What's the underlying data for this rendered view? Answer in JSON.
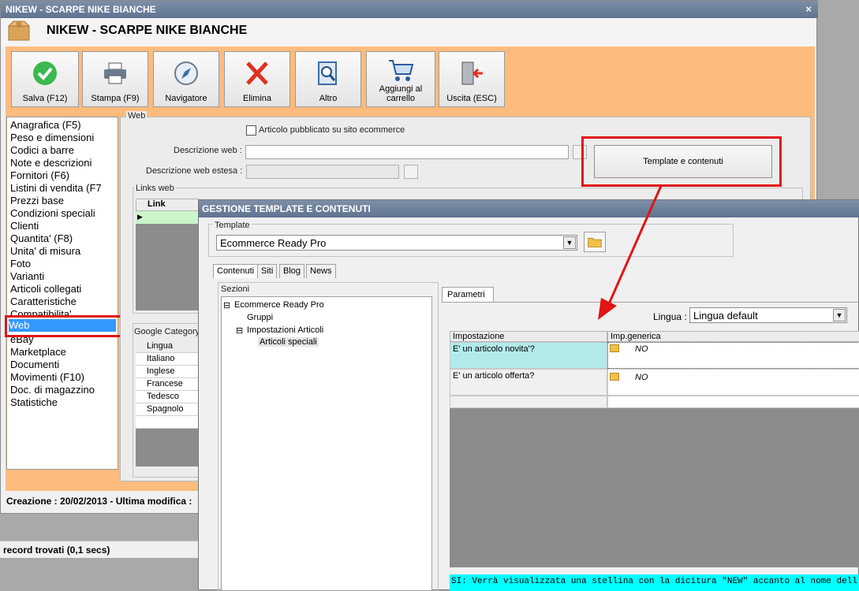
{
  "window": {
    "title": "NIKEW - SCARPE NIKE BIANCHE",
    "item_title": "NIKEW - SCARPE NIKE BIANCHE",
    "close": "×"
  },
  "toolbar": [
    {
      "label": "Salva (F12)",
      "icon": "check-icon"
    },
    {
      "label": "Stampa (F9)",
      "icon": "printer-icon"
    },
    {
      "label": "Navigatore",
      "icon": "compass-icon"
    },
    {
      "label": "Elimina",
      "icon": "delete-x-icon"
    },
    {
      "label": "Altro",
      "icon": "search-document-icon"
    },
    {
      "label": "Aggiungi al carrello",
      "icon": "cart-icon"
    },
    {
      "label": "Uscita (ESC)",
      "icon": "exit-door-icon"
    }
  ],
  "nav": {
    "items": [
      "Anagrafica (F5)",
      "Peso e dimensioni",
      "Codici a barre",
      "Note e descrizioni",
      "Fornitori (F6)",
      "Listini di vendita (F7",
      "Prezzi base",
      "Condizioni speciali",
      "Clienti",
      "Quantita' (F8)",
      "Unita' di misura",
      "Foto",
      "Varianti",
      "Articoli collegati",
      "Caratteristiche",
      "Compatibilita'",
      "Web",
      "eBay",
      "Marketplace",
      "Documenti",
      "Movimenti (F10)",
      "Doc. di magazzino",
      "Statistiche"
    ],
    "selected": "Web"
  },
  "web": {
    "group_label": "Web",
    "checkbox_label": "Articolo pubblicato su sito ecommerce",
    "descr_label": "Descrizione web :",
    "descr_value": "",
    "descr_ext_label": "Descrizione web estesa :",
    "template_button": "Template e contenuti",
    "links_label": "Links web",
    "links_col": "Link",
    "google_label": "Google Category",
    "languages": [
      "Lingua",
      "Italiano",
      "Inglese",
      "Francese",
      "Tedesco",
      "Spagnolo"
    ]
  },
  "status": {
    "creation": "Creazione : 20/02/2013 - Ultima modifica :",
    "records": "record trovati (0,1 secs)"
  },
  "dialog": {
    "title": "GESTIONE TEMPLATE E CONTENUTI",
    "template_label": "Template",
    "template_value": "Ecommerce Ready Pro",
    "tabs": [
      "Contenuti",
      "Siti",
      "Blog",
      "News"
    ],
    "sezioni_label": "Sezioni",
    "tree": [
      "Ecommerce Ready Pro",
      "Gruppi",
      "Impostazioni Articoli",
      "Articoli speciali"
    ],
    "param_tab": "Parametri",
    "lingua_label": "Lingua :",
    "lingua_value": "Lingua default",
    "grid_headers": [
      "Impostazione",
      "Imp.generica"
    ],
    "rows": [
      {
        "setting": "E' un articolo novita'?",
        "value": "NO"
      },
      {
        "setting": "E' un articolo offerta?",
        "value": "NO"
      }
    ],
    "info": "SI: Verrà visualizzata una stellina con la dicitura \"NEW\" accanto al nome dell'articolo."
  },
  "colors": {
    "accent_orange": "#fdbb7e",
    "highlight_red": "#e01515",
    "selection_blue": "#3399ff",
    "info_cyan": "#00ffff"
  }
}
